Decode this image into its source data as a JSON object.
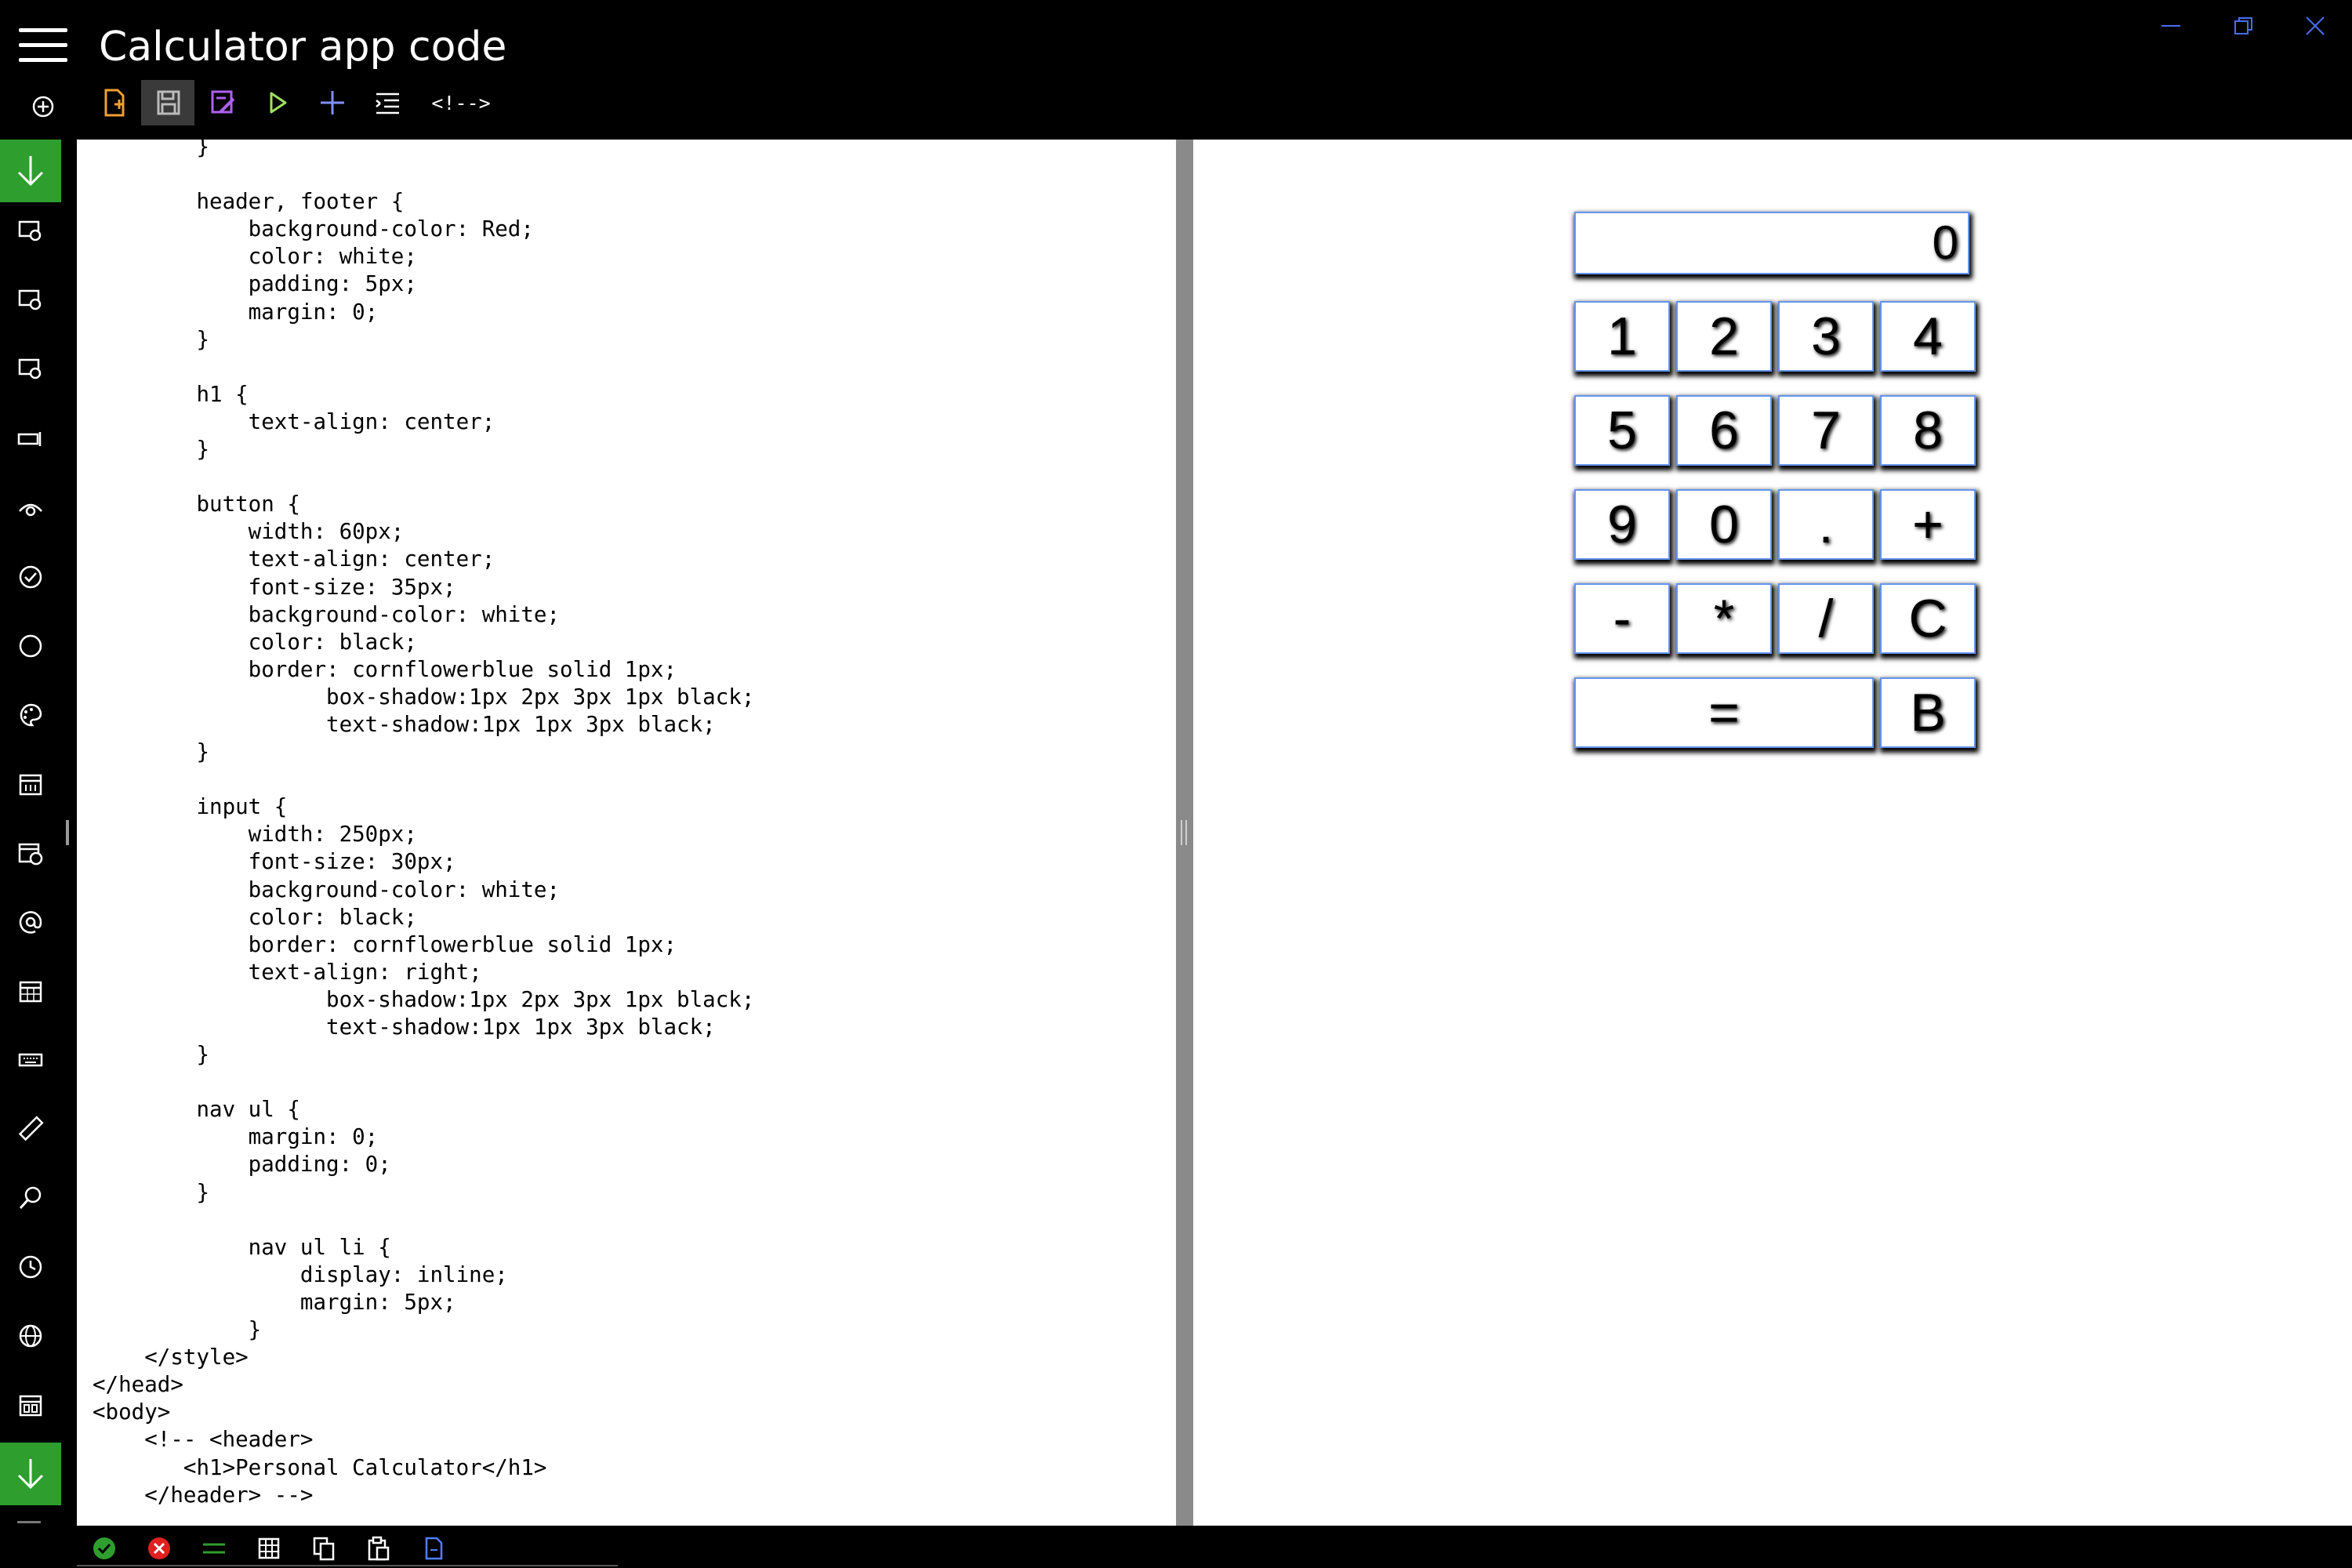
{
  "app": {
    "title": "Calculator app code"
  },
  "window_controls": {
    "minimize_icon": "minimize-icon",
    "restore_icon": "restore-icon",
    "close_icon": "close-icon"
  },
  "toolbar": {
    "tools": [
      {
        "icon": "new-file-icon",
        "color": "#f0a030"
      },
      {
        "icon": "save-icon",
        "color": "#bbbbbb",
        "active": true
      },
      {
        "icon": "save-as-icon",
        "color": "#b060f0"
      },
      {
        "icon": "run-icon",
        "color": "#a0e060"
      },
      {
        "icon": "insert-icon",
        "color": "#8090ff"
      },
      {
        "icon": "indent-icon",
        "color": "#ffffff"
      }
    ],
    "comment_label": "<!-->"
  },
  "editor": {
    "code": "        }\n\n        header, footer {\n            background-color: Red;\n            color: white;\n            padding: 5px;\n            margin: 0;\n        }\n\n        h1 {\n            text-align: center;\n        }\n\n        button {\n            width: 60px;\n            text-align: center;\n            font-size: 35px;\n            background-color: white;\n            color: black;\n            border: cornflowerblue solid 1px;\n                  box-shadow:1px 2px 3px 1px black;\n                  text-shadow:1px 1px 3px black;\n        }\n\n        input {\n            width: 250px;\n            font-size: 30px;\n            background-color: white;\n            color: black;\n            border: cornflowerblue solid 1px;\n            text-align: right;\n                  box-shadow:1px 2px 3px 1px black;\n                  text-shadow:1px 1px 3px black;\n        }\n\n        nav ul {\n            margin: 0;\n            padding: 0;\n        }\n\n            nav ul li {\n                display: inline;\n                margin: 5px;\n            }\n    </style>\n</head>\n<body>\n    <!-- <header>\n       <h1>Personal Calculator</h1>\n    </header> -->"
  },
  "preview": {
    "display_value": "0",
    "buttons": [
      {
        "label": "1",
        "row": 0,
        "col": 0,
        "span": 1
      },
      {
        "label": "2",
        "row": 0,
        "col": 1,
        "span": 1
      },
      {
        "label": "3",
        "row": 0,
        "col": 2,
        "span": 1
      },
      {
        "label": "4",
        "row": 0,
        "col": 3,
        "span": 1
      },
      {
        "label": "5",
        "row": 1,
        "col": 0,
        "span": 1
      },
      {
        "label": "6",
        "row": 1,
        "col": 1,
        "span": 1
      },
      {
        "label": "7",
        "row": 1,
        "col": 2,
        "span": 1
      },
      {
        "label": "8",
        "row": 1,
        "col": 3,
        "span": 1
      },
      {
        "label": "9",
        "row": 2,
        "col": 0,
        "span": 1
      },
      {
        "label": "0",
        "row": 2,
        "col": 1,
        "span": 1
      },
      {
        "label": ".",
        "row": 2,
        "col": 2,
        "span": 1
      },
      {
        "label": "+",
        "row": 2,
        "col": 3,
        "span": 1
      },
      {
        "label": "-",
        "row": 3,
        "col": 0,
        "span": 1
      },
      {
        "label": "*",
        "row": 3,
        "col": 1,
        "span": 1
      },
      {
        "label": "/",
        "row": 3,
        "col": 2,
        "span": 1
      },
      {
        "label": "C",
        "row": 3,
        "col": 3,
        "span": 1
      },
      {
        "label": "=",
        "row": 4,
        "col": 0,
        "span": 3
      },
      {
        "label": "B",
        "row": 4,
        "col": 3,
        "span": 1
      }
    ]
  },
  "sidebar": {
    "icons": [
      "scroll-down-icon",
      "snippet-1-icon",
      "snippet-2-icon",
      "snippet-3-icon",
      "form-field-icon",
      "view-icon",
      "check-circle-icon",
      "circle-icon",
      "palette-icon",
      "calendar-icon",
      "calendar-clock-icon",
      "at-icon",
      "calendar-grid-icon",
      "keyboard-icon",
      "ruler-icon",
      "search-icon",
      "clock-icon",
      "globe-icon",
      "calendar-week-icon",
      "scroll-down-icon"
    ]
  },
  "statusbar": {
    "icons": [
      "accept-icon",
      "reject-icon",
      "lines-icon",
      "grid-icon",
      "copy-icon",
      "paste-icon",
      "document-icon"
    ],
    "colors": {
      "accept": "#2e9e2e",
      "reject": "#e02020",
      "lines": "#2e9e2e"
    }
  }
}
